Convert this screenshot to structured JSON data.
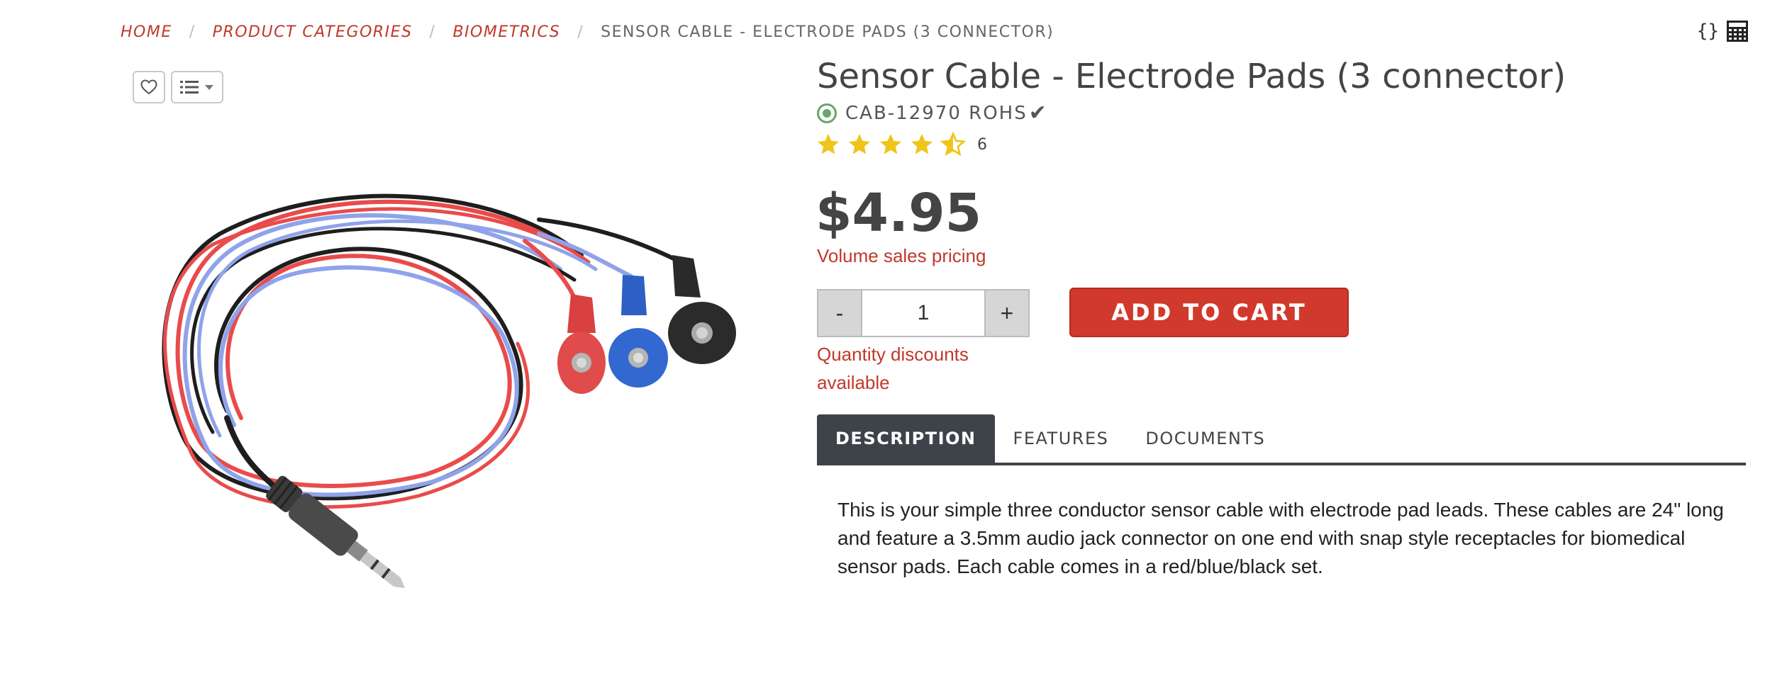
{
  "breadcrumb": {
    "items": [
      "HOME",
      "PRODUCT CATEGORIES",
      "BIOMETRICS"
    ],
    "separator": "/",
    "current": "SENSOR CABLE - ELECTRODE PADS (3 CONNECTOR)"
  },
  "tools": {
    "braces": "{}",
    "calculator_icon": "calculator-icon"
  },
  "wishlist": {
    "heart_icon": "heart-icon",
    "list_icon": "list-icon",
    "caret_icon": "caret-down-icon"
  },
  "product": {
    "title": "Sensor Cable - Electrode Pads (3 connector)",
    "status_icon": "in-stock-icon",
    "sku": "CAB-12970 ROHS",
    "rohs_check": "✔",
    "rating": {
      "value": 4.5,
      "max": 5,
      "count": "6"
    },
    "price": "$4.95",
    "volume_pricing_label": "Volume sales pricing",
    "quantity": {
      "minus": "-",
      "value": "1",
      "plus": "+"
    },
    "quantity_note": "Quantity discounts available",
    "add_to_cart_label": "ADD TO CART",
    "image_alt": "sensor cable with red, blue and black electrode snap connectors"
  },
  "tabs": [
    {
      "label": "DESCRIPTION",
      "active": true
    },
    {
      "label": "FEATURES",
      "active": false
    },
    {
      "label": "DOCUMENTS",
      "active": false
    }
  ],
  "description": "This is your simple three conductor sensor cable with electrode pad leads. These cables are 24\" long and feature a 3.5mm audio jack connector on one end with snap style receptacles for biomedical sensor pads. Each cable comes in a red/blue/black set.",
  "colors": {
    "accent_red": "#c0392b",
    "tab_dark": "#3d4349",
    "star_gold": "#f0c419",
    "status_green": "#6aa56a"
  }
}
